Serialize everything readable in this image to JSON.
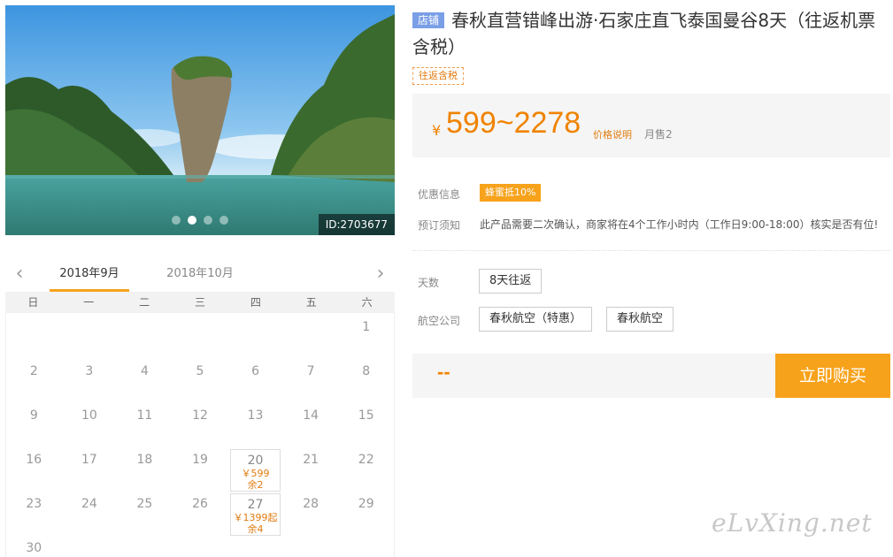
{
  "hero": {
    "image_id": "ID:2703677",
    "slide_count": 4,
    "active_slide": 2
  },
  "calendar": {
    "prev_icon": "chevron-left-icon",
    "next_icon": "chevron-right-icon",
    "months": [
      "2018年9月",
      "2018年10月"
    ],
    "weekdays": [
      "日",
      "一",
      "二",
      "三",
      "四",
      "五",
      "六"
    ],
    "days": [
      {
        "d": ""
      },
      {
        "d": ""
      },
      {
        "d": ""
      },
      {
        "d": ""
      },
      {
        "d": ""
      },
      {
        "d": ""
      },
      {
        "d": "1"
      },
      {
        "d": "2"
      },
      {
        "d": "3"
      },
      {
        "d": "4"
      },
      {
        "d": "5"
      },
      {
        "d": "6"
      },
      {
        "d": "7"
      },
      {
        "d": "8"
      },
      {
        "d": "9"
      },
      {
        "d": "10"
      },
      {
        "d": "11"
      },
      {
        "d": "12"
      },
      {
        "d": "13"
      },
      {
        "d": "14"
      },
      {
        "d": "15"
      },
      {
        "d": "16"
      },
      {
        "d": "17"
      },
      {
        "d": "18"
      },
      {
        "d": "19"
      },
      {
        "d": "20",
        "price": "￥599",
        "left": "余2"
      },
      {
        "d": "21"
      },
      {
        "d": "22"
      },
      {
        "d": "23"
      },
      {
        "d": "24"
      },
      {
        "d": "25"
      },
      {
        "d": "26"
      },
      {
        "d": "27",
        "price": "￥1399起",
        "left": "余4"
      },
      {
        "d": "28"
      },
      {
        "d": "29"
      },
      {
        "d": "30"
      }
    ]
  },
  "product": {
    "shop_tag": "店铺",
    "title": "春秋直营错峰出游·石家庄直飞泰国曼谷8天（往返机票含税）",
    "tag": "往返含税",
    "price_symbol": "¥",
    "price_range": "599~2278",
    "price_note": "价格说明",
    "sold": "月售2",
    "promo_label": "优惠信息",
    "promo_badge": "蜂蜜抵10%",
    "notice_label": "预订须知",
    "notice_text": "此产品需要二次确认，商家将在4个工作小时内（工作日9:00-18:00）核实是否有位!",
    "days_label": "天数",
    "days_option": "8天往返",
    "airline_label": "航空公司",
    "airline_options": [
      "春秋航空（特惠）",
      "春秋航空"
    ],
    "quantity_placeholder": "--",
    "buy_label": "立即购买"
  },
  "watermark": "eLvXing.net",
  "colors": {
    "accent": "#f7a21b",
    "price": "#f08300",
    "shop_tag": "#7b9fe6"
  }
}
